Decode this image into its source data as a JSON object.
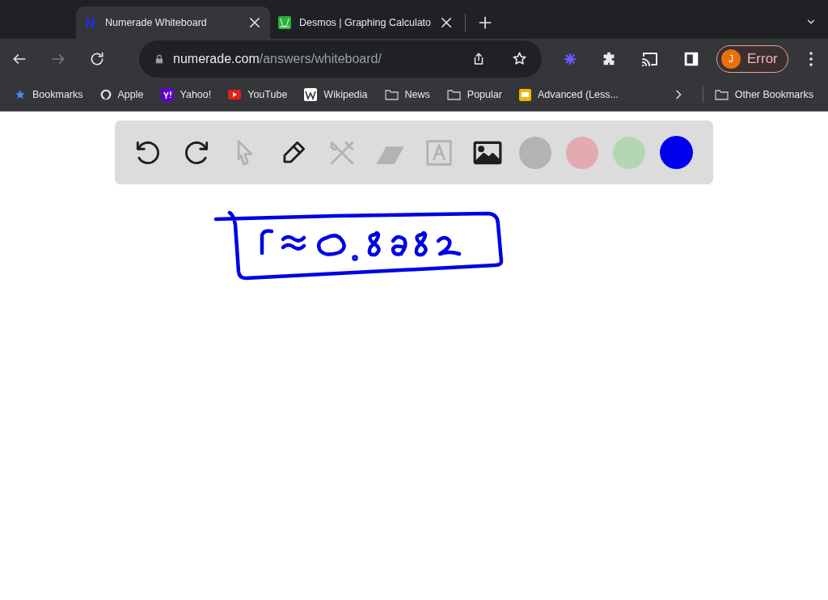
{
  "tabs": [
    {
      "title": "Numerade Whiteboard",
      "kind": "numerade",
      "selected": true
    },
    {
      "title": "Desmos | Graphing Calculato",
      "kind": "desmos",
      "selected": false
    }
  ],
  "address": {
    "host": "numerade.com",
    "path": "/answers/whiteboard/"
  },
  "profile": {
    "initial": "J",
    "label": "Error"
  },
  "bookmarks": [
    {
      "label": "Bookmarks",
      "kind": "star"
    },
    {
      "label": "Apple",
      "kind": "apple"
    },
    {
      "label": "Yahoo!",
      "kind": "yahoo"
    },
    {
      "label": "YouTube",
      "kind": "youtube"
    },
    {
      "label": "Wikipedia",
      "kind": "wikipedia"
    },
    {
      "label": "News",
      "kind": "folder"
    },
    {
      "label": "Popular",
      "kind": "folder"
    },
    {
      "label": "Advanced (Less...",
      "kind": "slides"
    }
  ],
  "other_bookmarks": "Other Bookmarks",
  "tools": [
    {
      "kind": "undo",
      "disabled": false
    },
    {
      "kind": "redo",
      "disabled": false
    },
    {
      "kind": "pointer",
      "disabled": true
    },
    {
      "kind": "pen",
      "disabled": false
    },
    {
      "kind": "tools",
      "disabled": true
    },
    {
      "kind": "eraser",
      "disabled": true
    },
    {
      "kind": "text",
      "disabled": true
    },
    {
      "kind": "image",
      "disabled": false
    }
  ],
  "colors": [
    {
      "color": "#b3b3b3",
      "selected": false
    },
    {
      "color": "#e3aab0",
      "selected": false
    },
    {
      "color": "#b5d6b2",
      "selected": false
    },
    {
      "color": "#0000f0",
      "selected": true
    }
  ]
}
